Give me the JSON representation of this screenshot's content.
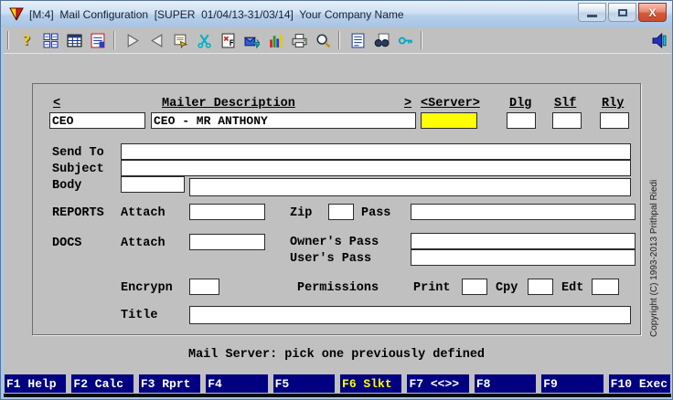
{
  "window": {
    "title": "[M:4]  Mail Configuration  [SUPER  01/04/13-31/03/14]  Your Company Name"
  },
  "toolbar": {
    "icons": [
      "help",
      "grid",
      "table",
      "calendar",
      "next",
      "previous",
      "properties",
      "cut",
      "form-f",
      "send-mail",
      "chart",
      "print",
      "zoom",
      "list",
      "find",
      "key",
      "exit"
    ]
  },
  "form": {
    "header": {
      "open": "<",
      "title": "Mailer Description",
      "close": ">",
      "server": "<Server>",
      "dlg": "Dlg",
      "slf": "Slf",
      "rly": "Rly"
    },
    "record": {
      "code": "CEO",
      "description": "CEO - MR ANTHONY",
      "server": "",
      "dlg": "",
      "slf": "",
      "rly": ""
    },
    "send_to": {
      "label": "Send To",
      "value": ""
    },
    "subject": {
      "label": "Subject",
      "value": ""
    },
    "body": {
      "label": "Body",
      "value1": "",
      "value2": ""
    },
    "reports": {
      "label": "REPORTS",
      "attach_label": "Attach",
      "attach": "",
      "zip_label": "Zip",
      "zip": "",
      "pass_label": "Pass",
      "pass": ""
    },
    "docs": {
      "label": "DOCS",
      "attach_label": "Attach",
      "attach": "",
      "owners_pass_label": "Owner's Pass",
      "owners_pass": "",
      "users_pass_label": "User's Pass",
      "users_pass": ""
    },
    "encryption": {
      "label": "Encrypn",
      "value": "",
      "permissions_label": "Permissions",
      "print_label": "Print",
      "print": "",
      "cpy_label": "Cpy",
      "cpy": "",
      "edt_label": "Edt",
      "edt": ""
    },
    "title_row": {
      "label": "Title",
      "value": ""
    }
  },
  "status": {
    "message": "Mail Server: pick one previously defined"
  },
  "function_keys": [
    {
      "label": "F1 Help",
      "highlight": false
    },
    {
      "label": "F2 Calc",
      "highlight": false
    },
    {
      "label": "F3 Rprt",
      "highlight": false
    },
    {
      "label": "F4",
      "highlight": false
    },
    {
      "label": "F5",
      "highlight": false
    },
    {
      "label": "F6 Slkt",
      "highlight": true
    },
    {
      "label": "F7 <<>>",
      "highlight": false
    },
    {
      "label": "F8",
      "highlight": false
    },
    {
      "label": "F9",
      "highlight": false
    },
    {
      "label": "F10 Exec",
      "highlight": false
    }
  ],
  "copyright": {
    "text": "Copyright (C) 1993-2013 Prithpal Riedi"
  },
  "colors": {
    "focused_field_bg": "#ffff00",
    "fkey_bg": "#000080",
    "fkey_text": "#ffffff",
    "fkey_highlight_text": "#ffff00",
    "desktop_bg": "#c0c0c0",
    "titlebar_bg": "#cfe0f3"
  }
}
